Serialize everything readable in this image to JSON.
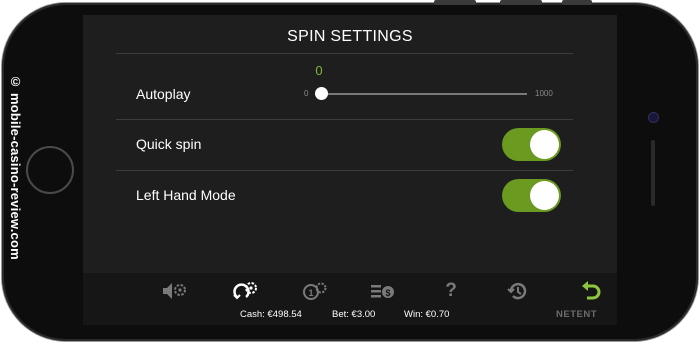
{
  "watermark": "© mobile-casino-review.com",
  "settings": {
    "title": "SPIN SETTINGS",
    "autoplay": {
      "label": "Autoplay",
      "value": "0",
      "min": "0",
      "max": "1000",
      "fraction": 0
    },
    "quick_spin": {
      "label": "Quick spin",
      "on": true
    },
    "left_hand_mode": {
      "label": "Left Hand Mode",
      "on": true
    }
  },
  "toolbar": {
    "icons": [
      "sound-settings-icon",
      "spin-settings-icon",
      "coin-settings-icon",
      "paytable-icon",
      "help-icon",
      "history-icon",
      "back-icon"
    ],
    "help_glyph": "?",
    "cash_label": "Cash:",
    "cash_value": "€498.54",
    "bet_label": "Bet:",
    "bet_value": "€3.00",
    "win_label": "Win:",
    "win_value": "€0.70",
    "brand": "NETENT"
  },
  "colors": {
    "accent": "#7db53b",
    "toggle_on": "#6a9a1f",
    "back_icon": "#8cc63f",
    "inactive_icon": "#7a7a7a"
  }
}
